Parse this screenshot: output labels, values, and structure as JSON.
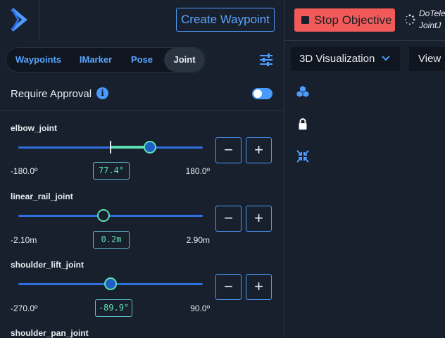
{
  "header": {
    "create_waypoint_label": "Create Waypoint",
    "stop_objective_label": "Stop Objective",
    "status_line1": "DoTele",
    "status_line2": "JointJ"
  },
  "tabs": [
    {
      "label": "Waypoints",
      "active": false
    },
    {
      "label": "IMarker",
      "active": false
    },
    {
      "label": "Pose",
      "active": false
    },
    {
      "label": "Joint",
      "active": true
    }
  ],
  "approval": {
    "label": "Require Approval",
    "info_glyph": "i",
    "enabled": true
  },
  "joints": [
    {
      "name": "elbow_joint",
      "min_label": "-180.0º",
      "max_label": "180.0º",
      "value_label": "77.4°",
      "min": -180,
      "max": 180,
      "value": 77.4,
      "reference": 0,
      "minus": "−",
      "plus": "+"
    },
    {
      "name": "linear_rail_joint",
      "min_label": "-2.10m",
      "max_label": "2.90m",
      "value_label": "0.2m",
      "min": -2.1,
      "max": 2.9,
      "value": 0.2,
      "reference": 0.2,
      "minus": "−",
      "plus": "+"
    },
    {
      "name": "shoulder_lift_joint",
      "min_label": "-270.0º",
      "max_label": "90.0º",
      "value_label": "-89.9°",
      "min": -270,
      "max": 90,
      "value": -89.9,
      "reference": -89.9,
      "minus": "−",
      "plus": "+"
    },
    {
      "name": "shoulder_pan_joint"
    }
  ],
  "right": {
    "visualization_label": "3D Visualization",
    "view_label": "View"
  },
  "colors": {
    "background": "#17202c",
    "accent_blue": "#4e9bff",
    "accent_green": "#5fe0b3",
    "stop_red": "#f25a5a"
  },
  "icons": [
    "app-logo-icon",
    "spinner-icon",
    "tune-icon",
    "info-icon",
    "cubes-icon",
    "lock-icon",
    "collapse-icon",
    "chevron-down-icon"
  ]
}
